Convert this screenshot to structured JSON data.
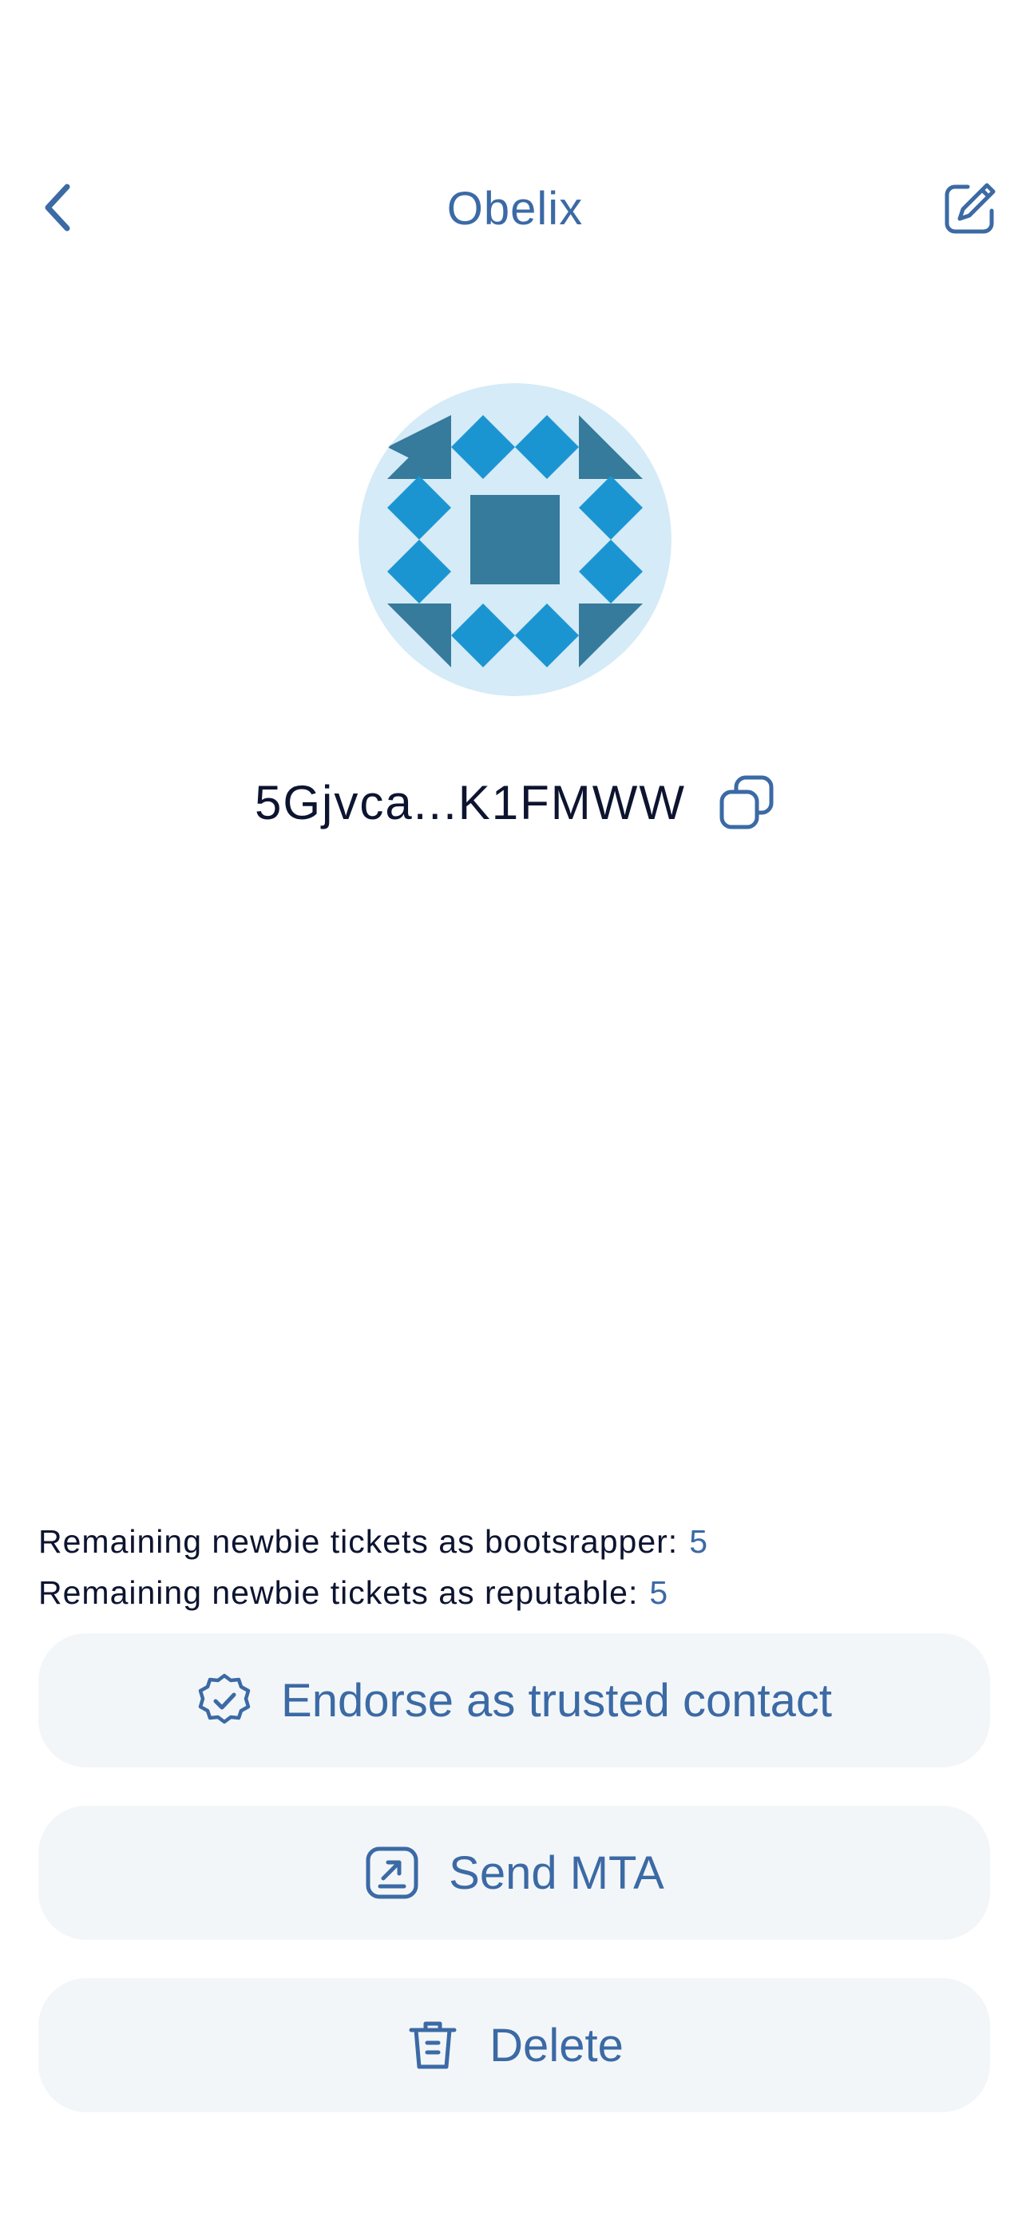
{
  "header": {
    "title": "Obelix",
    "back_icon": "chevron-left-icon",
    "edit_icon": "edit-icon"
  },
  "profile": {
    "address": "5Gjvca...K1FMWW",
    "copy_icon": "copy-icon",
    "avatar_colors": {
      "background": "#d5ebf7",
      "light": "#1b95d2",
      "dark": "#367a9c"
    }
  },
  "tickets": {
    "bootstrapper_label": "Remaining newbie tickets as bootsrapper:",
    "bootstrapper_value": "5",
    "reputable_label": "Remaining newbie tickets as reputable:",
    "reputable_value": "5"
  },
  "actions": [
    {
      "label": "Endorse as trusted contact",
      "icon": "verified-badge-icon"
    },
    {
      "label": "Send MTA",
      "icon": "send-arrow-icon"
    },
    {
      "label": "Delete",
      "icon": "trash-icon"
    }
  ],
  "colors": {
    "accent": "#3b6aa5",
    "text": "#0d1430",
    "button_bg": "#f3f6f8"
  }
}
